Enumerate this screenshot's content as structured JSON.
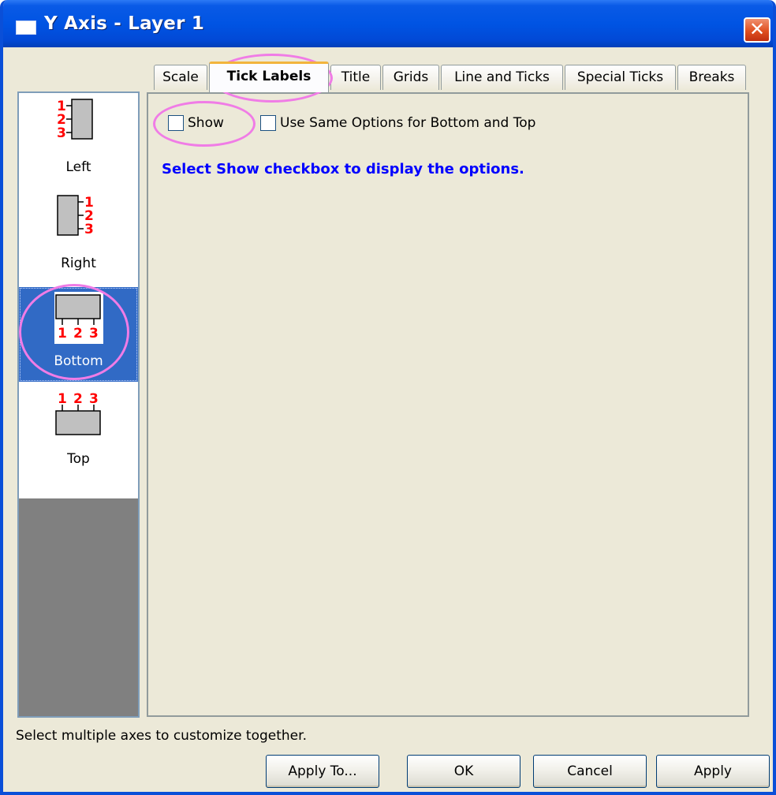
{
  "window": {
    "title": "Y Axis - Layer 1",
    "close_glyph": "✕"
  },
  "tabs": [
    {
      "label": "Scale"
    },
    {
      "label": "Tick Labels",
      "active": true
    },
    {
      "label": "Title"
    },
    {
      "label": "Grids"
    },
    {
      "label": "Line and Ticks"
    },
    {
      "label": "Special Ticks"
    },
    {
      "label": "Breaks"
    }
  ],
  "sidebar": {
    "items": [
      {
        "label": "Left",
        "icon": "axis-left-icon"
      },
      {
        "label": "Right",
        "icon": "axis-right-icon"
      },
      {
        "label": "Bottom",
        "icon": "axis-bottom-icon",
        "selected": true
      },
      {
        "label": "Top",
        "icon": "axis-top-icon"
      }
    ],
    "tick_numbers": [
      "1",
      "2",
      "3"
    ]
  },
  "options": {
    "show": {
      "label": "Show",
      "checked": false
    },
    "same_options": {
      "label": "Use Same Options for Bottom and Top",
      "checked": false
    }
  },
  "info_text": "Select Show checkbox to display the options.",
  "status_text": "Select multiple axes to customize together.",
  "buttons": {
    "apply_to": "Apply To...",
    "ok": "OK",
    "cancel": "Cancel",
    "apply": "Apply"
  },
  "colors": {
    "title_bar": "#0054e3",
    "selection": "#316ac5",
    "info_text": "#0000ff",
    "tick_numbers": "#ff0000",
    "highlight_annotation": "#f07ce6"
  }
}
